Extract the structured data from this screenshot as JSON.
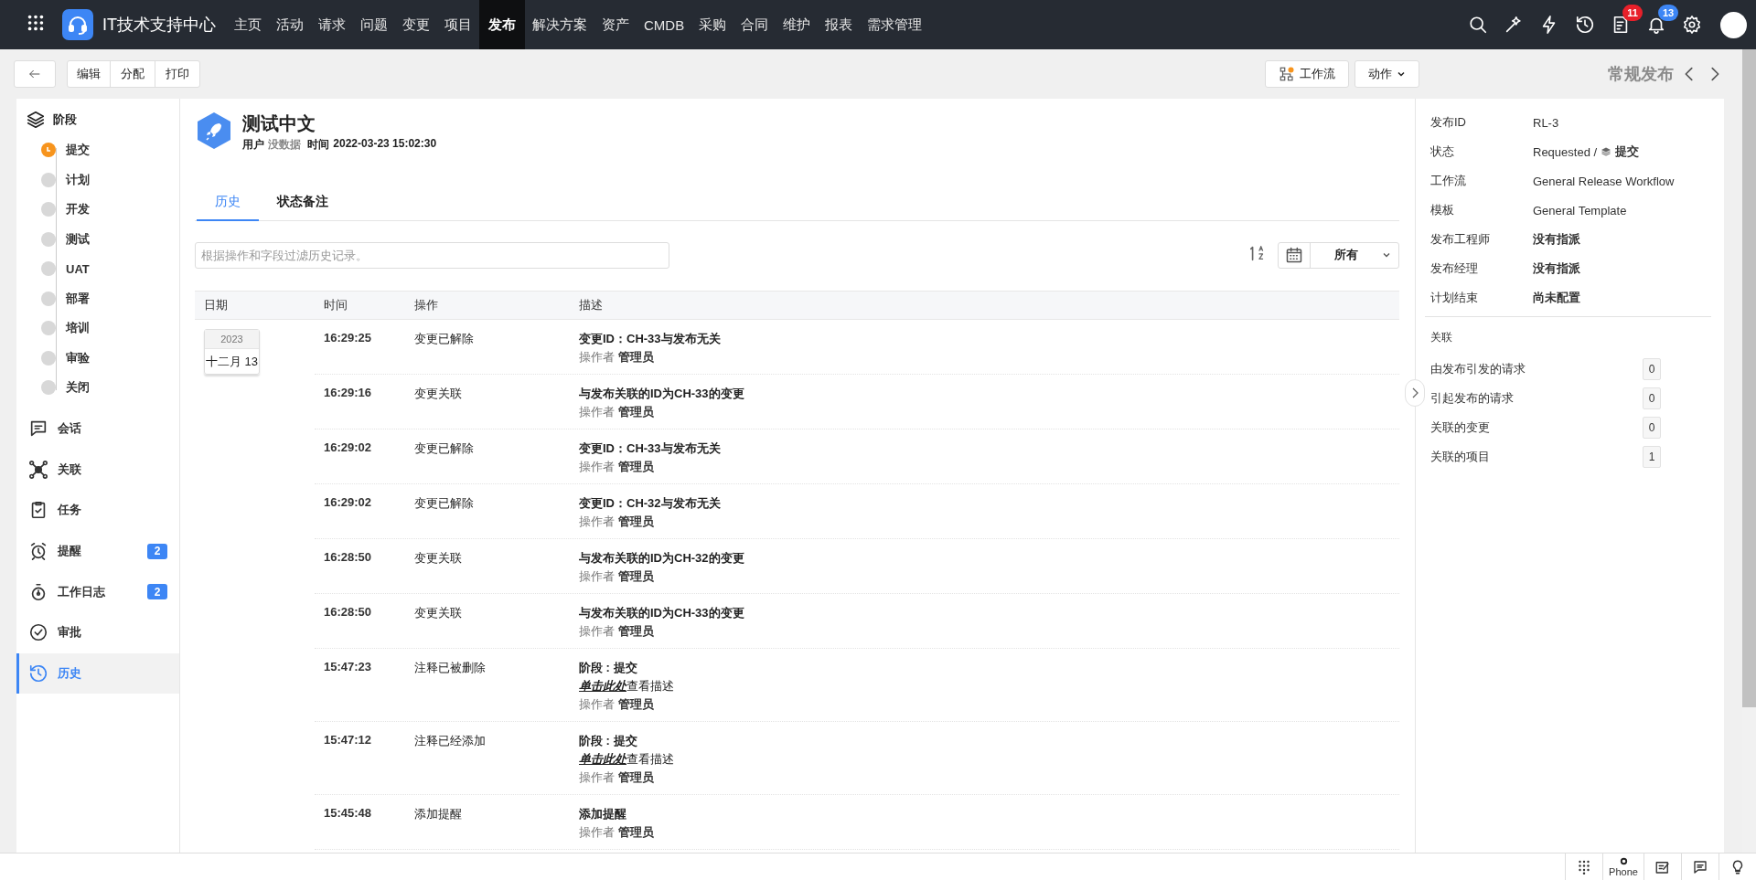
{
  "top_bar": {
    "app_title": "IT技术支持中心",
    "nav": [
      {
        "label": "主页",
        "selected": false
      },
      {
        "label": "活动",
        "selected": false
      },
      {
        "label": "请求",
        "selected": false
      },
      {
        "label": "问题",
        "selected": false
      },
      {
        "label": "变更",
        "selected": false
      },
      {
        "label": "项目",
        "selected": false
      },
      {
        "label": "发布",
        "selected": true
      },
      {
        "label": "解决方案",
        "selected": false
      },
      {
        "label": "资产",
        "selected": false
      },
      {
        "label": "CMDB",
        "selected": false
      },
      {
        "label": "采购",
        "selected": false
      },
      {
        "label": "合同",
        "selected": false
      },
      {
        "label": "维护",
        "selected": false
      },
      {
        "label": "报表",
        "selected": false
      },
      {
        "label": "需求管理",
        "selected": false
      }
    ],
    "badges": [
      {
        "count": "11",
        "color": "#e8202a"
      },
      {
        "count": "13",
        "color": "#3d86f5"
      }
    ]
  },
  "toolbar": {
    "actions": [
      "编辑",
      "分配",
      "打印"
    ],
    "workflow_button": "工作流",
    "action_menu": "动作",
    "record_type": "常规发布"
  },
  "sidebar": {
    "stage_heading": "阶段",
    "stages": [
      {
        "label": "提交",
        "selected": true
      },
      {
        "label": "计划",
        "selected": false
      },
      {
        "label": "开发",
        "selected": false
      },
      {
        "label": "测试",
        "selected": false
      },
      {
        "label": "UAT",
        "selected": false
      },
      {
        "label": "部署",
        "selected": false
      },
      {
        "label": "培训",
        "selected": false
      },
      {
        "label": "审验",
        "selected": false
      },
      {
        "label": "关闭",
        "selected": false
      }
    ],
    "items": [
      {
        "label": "会话",
        "selected": false
      },
      {
        "label": "关联",
        "selected": false
      },
      {
        "label": "任务",
        "selected": false
      },
      {
        "label": "提醒",
        "selected": false,
        "badge": "2"
      },
      {
        "label": "工作日志",
        "selected": false,
        "badge": "2"
      },
      {
        "label": "审批",
        "selected": false
      },
      {
        "label": "历史",
        "selected": true
      }
    ]
  },
  "record": {
    "title": "测试中文",
    "user_label": "用户",
    "user_value": "没数据",
    "time_label": "时间",
    "time_value": "2022-03-23 15:02:30"
  },
  "tabs": [
    {
      "label": "历史",
      "selected": true
    },
    {
      "label": "状态备注",
      "selected": false
    }
  ],
  "filter": {
    "placeholder": "根据操作和字段过滤历史记录。",
    "range": "所有"
  },
  "history": {
    "columns": [
      "日期",
      "时间",
      "操作",
      "描述"
    ],
    "date": {
      "year": "2023",
      "day": "十二月 13"
    },
    "rows": [
      {
        "time": "16:29:25",
        "action": "变更已解除",
        "lines": [
          {
            "kind": "text",
            "text": "变更ID：CH-33与发布无关"
          },
          {
            "kind": "operator",
            "text": "操作者 **管理员**"
          }
        ]
      },
      {
        "time": "16:29:16",
        "action": "变更关联",
        "lines": [
          {
            "kind": "text",
            "text": "与发布关联的ID为CH-33的变更"
          },
          {
            "kind": "operator",
            "text": "操作者 **管理员**"
          }
        ]
      },
      {
        "time": "16:29:02",
        "action": "变更已解除",
        "lines": [
          {
            "kind": "text",
            "text": "变更ID：CH-33与发布无关"
          },
          {
            "kind": "operator",
            "text": "操作者 **管理员**"
          }
        ]
      },
      {
        "time": "16:29:02",
        "action": "变更已解除",
        "lines": [
          {
            "kind": "text",
            "text": "变更ID：CH-32与发布无关"
          },
          {
            "kind": "operator",
            "text": "操作者 **管理员**"
          }
        ]
      },
      {
        "time": "16:28:50",
        "action": "变更关联",
        "lines": [
          {
            "kind": "text",
            "text": "与发布关联的ID为CH-32的变更"
          },
          {
            "kind": "operator",
            "text": "操作者 **管理员**"
          }
        ]
      },
      {
        "time": "16:28:50",
        "action": "变更关联",
        "lines": [
          {
            "kind": "text",
            "text": "与发布关联的ID为CH-33的变更"
          },
          {
            "kind": "operator",
            "text": "操作者 **管理员**"
          }
        ]
      },
      {
        "time": "15:47:23",
        "action": "注释已被删除",
        "lines": [
          {
            "kind": "text",
            "text": "阶段 : 提交"
          },
          {
            "kind": "link",
            "link": "单击此处",
            "text": "查看描述"
          },
          {
            "kind": "operator",
            "text": "操作者 **管理员**"
          }
        ]
      },
      {
        "time": "15:47:12",
        "action": "注释已经添加",
        "lines": [
          {
            "kind": "text",
            "text": "阶段 : 提交"
          },
          {
            "kind": "link",
            "link": "单击此处",
            "text": "查看描述"
          },
          {
            "kind": "operator",
            "text": "操作者 **管理员**"
          }
        ]
      },
      {
        "time": "15:45:48",
        "action": "添加提醒",
        "lines": [
          {
            "kind": "text",
            "text": "添加提醒"
          },
          {
            "kind": "operator",
            "text": "操作者 **管理员**"
          }
        ]
      }
    ]
  },
  "details": {
    "fields": [
      {
        "label": "发布ID",
        "value": "RL-3"
      },
      {
        "label": "状态",
        "value": "Requested /",
        "stage": "提交"
      },
      {
        "label": "工作流",
        "value": "General Release Workflow"
      },
      {
        "label": "模板",
        "value": "General Template"
      },
      {
        "label": "发布工程师",
        "value": "没有指派"
      },
      {
        "label": "发布经理",
        "value": "没有指派"
      },
      {
        "label": "计划结束",
        "value": "尚未配置"
      }
    ],
    "relations_heading": "关联",
    "relations": [
      {
        "label": "由发布引发的请求",
        "count": "0"
      },
      {
        "label": "引起发布的请求",
        "count": "0"
      },
      {
        "label": "关联的变更",
        "count": "0"
      },
      {
        "label": "关联的项目",
        "count": "1"
      }
    ]
  },
  "bottom_bar": {
    "phone_label": "Phone"
  }
}
